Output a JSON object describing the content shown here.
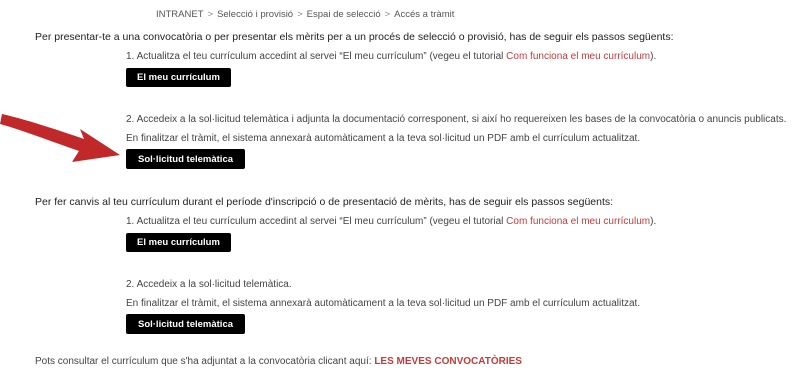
{
  "breadcrumb": [
    "INTRANET",
    "Selecció i provisió",
    "Espai de selecció",
    "Accés a tràmit"
  ],
  "breadcrumb_separator": ">",
  "section1": {
    "intro": "Per presentar-te a una convocatòria o per presentar els mèrits per a un procés de selecció o provisió, has de seguir els passos següents:",
    "step1_text": "1. Actualitza el teu currículum accedint al servei “El meu currículum” (vegeu el tutorial ",
    "step1_link": "Com funciona el meu currículum",
    "step1_end": ").",
    "button1": "El meu currículum",
    "step2_text": "2. Accedeix a la sol·licitud telemàtica i adjunta la documentació corresponent, si així ho requereixen les bases de la convocatòria o anuncis publicats.",
    "step2_note": "En finalitzar el tràmit, el sistema annexarà automàticament a la teva sol·licitud un PDF amb el currículum actualitzat.",
    "button2": "Sol·licitud telemàtica"
  },
  "section2": {
    "intro": "Per fer canvis al teu currículum durant el període d'inscripció o de presentació de mèrits, has de seguir els passos següents:",
    "step1_text": "1. Actualitza el teu currículum accedint al servei “El meu currículum” (vegeu el tutorial ",
    "step1_link": "Com funciona el meu currículum",
    "step1_end": ").",
    "button1": "El meu currículum",
    "step2_text": "2. Accedeix a la sol·licitud telemàtica.",
    "step2_note": "En finalitzar el tràmit, el sistema annexarà automàticament a la teva sol·licitud un PDF amb el currículum actualitzat.",
    "button2": "Sol·licitud telemàtica"
  },
  "footer": {
    "text": "Pots consultar el currículum que s'ha adjuntat a la convocatòria clicant aquí: ",
    "link": "LES MEVES CONVOCATÒRIES"
  },
  "colors": {
    "link": "#c23b3b",
    "arrow": "#c0282a",
    "button_bg": "#000000"
  },
  "icons": {
    "arrow": "red-arrow-icon"
  }
}
